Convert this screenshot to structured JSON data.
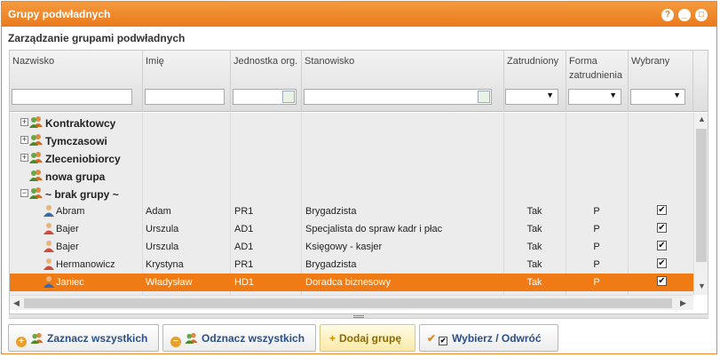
{
  "window": {
    "title": "Grupy podwładnych",
    "help": "?",
    "minimize": "_",
    "maximize": "□"
  },
  "subtitle": "Zarządzanie grupami podwładnych",
  "columns": [
    {
      "label": "Nazwisko"
    },
    {
      "label": "Imię"
    },
    {
      "label": "Jednostka org."
    },
    {
      "label": "Stanowisko"
    },
    {
      "label": "Zatrudniony"
    },
    {
      "label": "Forma zatrudnienia"
    },
    {
      "label": "Wybrany"
    }
  ],
  "groups": [
    {
      "name": "Kontraktowcy",
      "expander": "+"
    },
    {
      "name": "Tymczasowi",
      "expander": "+"
    },
    {
      "name": "Zleceniobiorcy",
      "expander": "+"
    },
    {
      "name": "nowa grupa",
      "expander": ""
    },
    {
      "name": "~ brak grupy ~",
      "expander": "−"
    }
  ],
  "rows": [
    {
      "nazwisko": "Abram",
      "imie": "Adam",
      "jednostka": "PR1",
      "stanowisko": "Brygadzista",
      "zatrudniony": "Tak",
      "forma": "P",
      "wybrany": "✔",
      "gender": "m"
    },
    {
      "nazwisko": "Bajer",
      "imie": "Urszula",
      "jednostka": "AD1",
      "stanowisko": "Specjalista do spraw kadr i płac",
      "zatrudniony": "Tak",
      "forma": "P",
      "wybrany": "✔",
      "gender": "f"
    },
    {
      "nazwisko": "Bajer",
      "imie": "Urszula",
      "jednostka": "AD1",
      "stanowisko": "Księgowy - kasjer",
      "zatrudniony": "Tak",
      "forma": "P",
      "wybrany": "✔",
      "gender": "f"
    },
    {
      "nazwisko": "Hermanowicz",
      "imie": "Krystyna",
      "jednostka": "PR1",
      "stanowisko": "Brygadzista",
      "zatrudniony": "Tak",
      "forma": "P",
      "wybrany": "✔",
      "gender": "f"
    },
    {
      "nazwisko": "Janiec",
      "imie": "Władysław",
      "jednostka": "HD1",
      "stanowisko": "Doradca biznesowy",
      "zatrudniony": "Tak",
      "forma": "P",
      "wybrany": "✔",
      "gender": "m",
      "selected": true
    }
  ],
  "buttons": {
    "select_all": "Zaznacz wszystkich",
    "deselect_all": "Odznacz wszystkich",
    "add_group": "Dodaj grupę",
    "choose": "Wybierz / Odwróć"
  },
  "colors": {
    "accent": "#ea7a1c",
    "selected_row": "#f07b14"
  }
}
